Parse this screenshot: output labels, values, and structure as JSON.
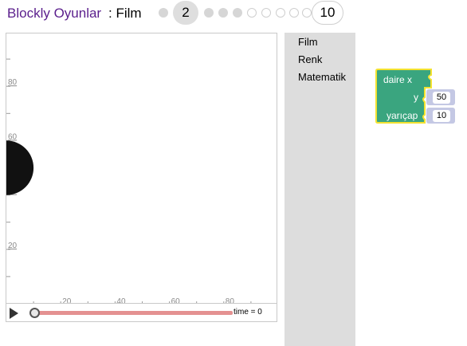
{
  "header": {
    "title_link": "Blockly Oyunlar",
    "title_sep": ": Film",
    "current_level": "2",
    "last_level": "10",
    "dots_filled": 4,
    "dots_empty": 5
  },
  "display": {
    "y_ticks": [
      "80",
      "60",
      "40",
      "20"
    ],
    "x_ticks": [
      "20",
      "40",
      "60",
      "80"
    ],
    "circle": {
      "x": 0,
      "y": 50,
      "r": 10,
      "color": "#111111"
    }
  },
  "controls": {
    "time_label": "time = 0",
    "progress": 0
  },
  "toolbox": {
    "categories": [
      "Film",
      "Renk",
      "Matematik"
    ]
  },
  "block": {
    "label_main": "daire x",
    "label_y": "y",
    "label_r": "yarıçap",
    "y_value": "50",
    "r_value": "10",
    "color": "#3aa57f",
    "highlight": "#f3e230"
  }
}
